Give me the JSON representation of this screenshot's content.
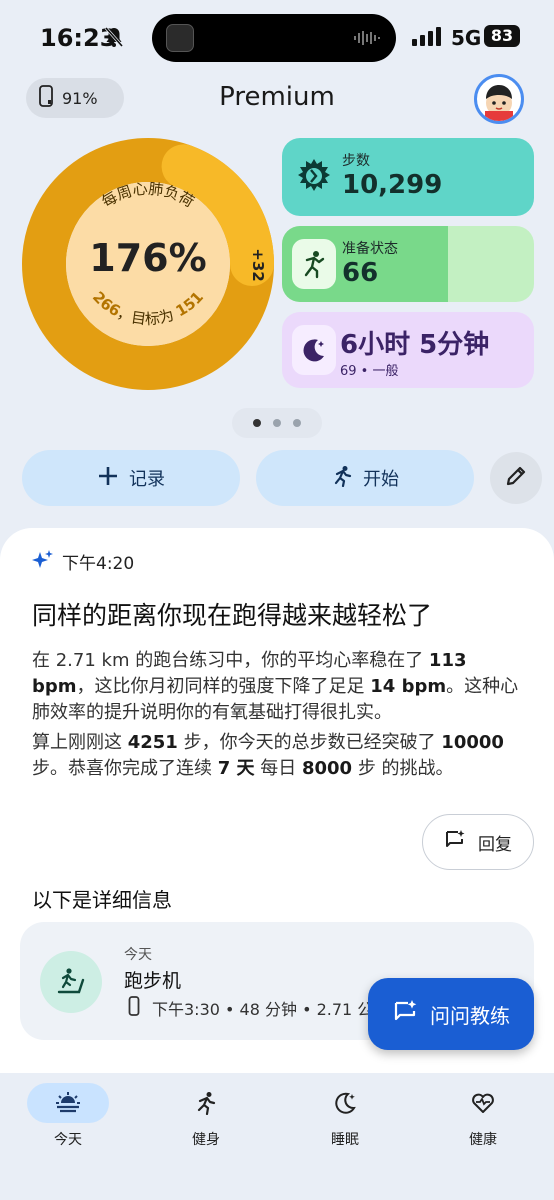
{
  "status": {
    "time": "16:23",
    "network": "5G",
    "battery": "83"
  },
  "header": {
    "battery_chip": "91%",
    "title": "Premium"
  },
  "ring": {
    "label": "每周心肺负荷",
    "percent": "176%",
    "plus": "+32",
    "current": "266",
    "target_text": "，目标为",
    "target": "151",
    "progress_fraction": 1.76
  },
  "cards": {
    "steps": {
      "label": "步数",
      "value": "10,299"
    },
    "readiness": {
      "label": "准备状态",
      "value": "66",
      "fill_fraction": 0.66
    },
    "sleep": {
      "hours": "6",
      "hours_unit": "小时",
      "minutes": "5",
      "minutes_unit": "分钟",
      "sub": "69 • 一般"
    }
  },
  "pager": {
    "count": 3,
    "active": 0
  },
  "actions": {
    "record": "记录",
    "start": "开始"
  },
  "insight": {
    "time": "下午4:20",
    "headline": "同样的距离你现在跑得越来越轻松了",
    "p1": {
      "a": "在 2.71 km 的跑台练习中，你的平均心率稳在了 ",
      "b": "113 bpm",
      "c": "，这比你月初同样的强度下降了足足 ",
      "d": "14 bpm",
      "e": "。这种心肺效率的提升说明你的有氧基础打得很扎实。"
    },
    "p2": {
      "a": "算上刚刚这 ",
      "b": "4251",
      "c": " 步，你今天的总步数已经突破了 ",
      "d": "10000",
      "e": " 步。恭喜你完成了连续 ",
      "f": "7 天",
      "g": " 每日 ",
      "h": "8000",
      "i": " 步 的挑战。"
    },
    "reply": "回复"
  },
  "details": {
    "title": "以下是详细信息",
    "activity": {
      "day": "今天",
      "name": "跑步机",
      "meta": "下午3:30 • 48 分钟 • 2.71 公里"
    }
  },
  "coach_button": "问问教练",
  "nav": {
    "today": "今天",
    "fitness": "健身",
    "sleep": "睡眠",
    "health": "健康"
  },
  "colors": {
    "ring_primary": "#e39e12",
    "ring_extra": "#f7b928",
    "ring_center": "#fcdca6",
    "accent_blue": "#1a5ed3",
    "steps_card": "#5fd5c8",
    "readiness_card": "#79d98a",
    "sleep_card": "#ebd9fb"
  }
}
